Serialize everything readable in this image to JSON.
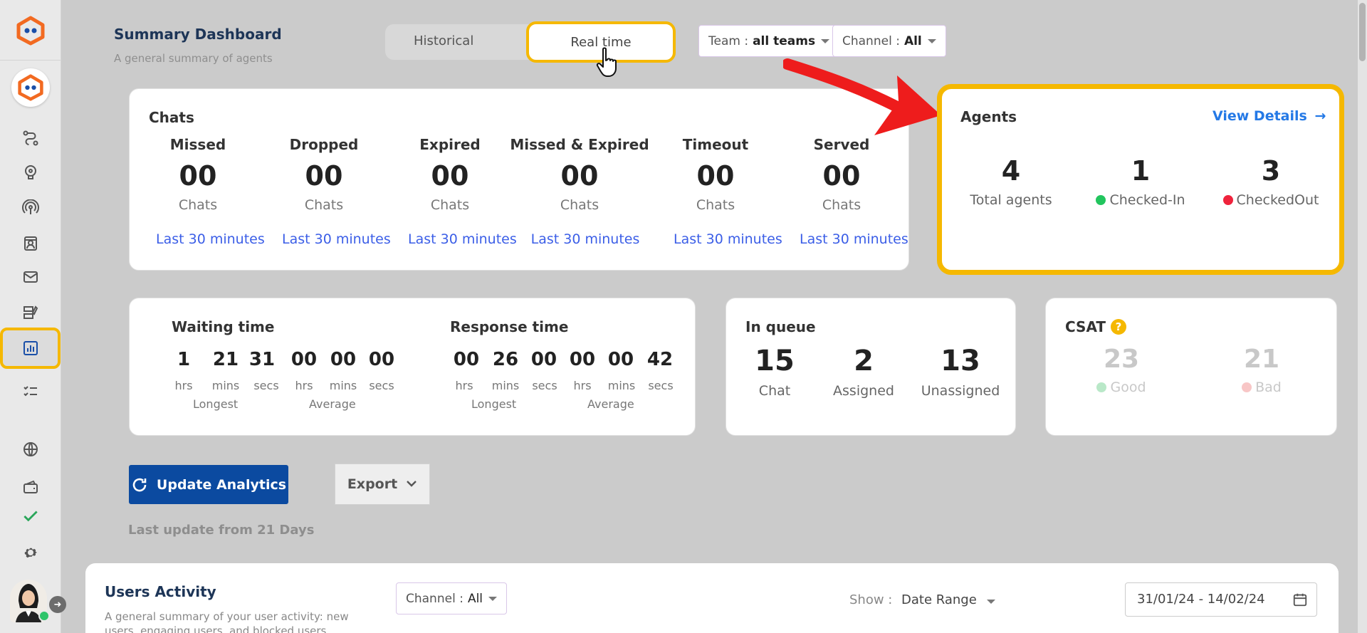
{
  "header": {
    "title": "Summary Dashboard",
    "subtitle": "A general summary of agents",
    "tabs": [
      "Historical",
      "Real time"
    ],
    "team_label": "Team :",
    "team_value": "all teams",
    "channel_label": "Channel :",
    "channel_value": "All"
  },
  "chats": {
    "title": "Chats",
    "columns": [
      {
        "label": "Missed",
        "value": "00",
        "unit": "Chats",
        "period": "Last 30 minutes"
      },
      {
        "label": "Dropped",
        "value": "00",
        "unit": "Chats",
        "period": "Last 30 minutes"
      },
      {
        "label": "Expired",
        "value": "00",
        "unit": "Chats",
        "period": "Last 30 minutes"
      },
      {
        "label": "Missed & Expired",
        "value": "00",
        "unit": "Chats",
        "period": "Last 30 minutes"
      },
      {
        "label": "Timeout",
        "value": "00",
        "unit": "Chats",
        "period": "Last 30 minutes"
      },
      {
        "label": "Served",
        "value": "00",
        "unit": "Chats",
        "period": "Last 30 minutes"
      }
    ]
  },
  "agents": {
    "title": "Agents",
    "view_details": "View Details",
    "total": "4",
    "total_label": "Total agents",
    "checked_in": "1",
    "checked_in_label": "Checked-In",
    "checked_out": "3",
    "checked_out_label": "CheckedOut",
    "checked_in_color": "#22c55e",
    "checked_out_color": "#ef233c"
  },
  "waiting_time": {
    "title": "Waiting time",
    "values": [
      "1",
      "21",
      "31",
      "00",
      "00",
      "00"
    ],
    "units": [
      "hrs",
      "mins",
      "secs",
      "hrs",
      "mins",
      "secs"
    ],
    "longest": "Longest",
    "average": "Average"
  },
  "response_time": {
    "title": "Response time",
    "values": [
      "00",
      "26",
      "00",
      "00",
      "00",
      "42"
    ],
    "units": [
      "hrs",
      "mins",
      "secs",
      "hrs",
      "mins",
      "secs"
    ],
    "longest": "Longest",
    "average": "Average"
  },
  "queue": {
    "title": "In queue",
    "chat": "15",
    "chat_label": "Chat",
    "assigned": "2",
    "assigned_label": "Assigned",
    "unassigned": "13",
    "unassigned_label": "Unassigned"
  },
  "csat": {
    "title": "CSAT",
    "good": "23",
    "good_label": "Good",
    "bad": "21",
    "bad_label": "Bad"
  },
  "actions": {
    "update": "Update Analytics",
    "export": "Export",
    "last_update": "Last update from 21 Days"
  },
  "users_activity": {
    "title": "Users Activity",
    "subtitle": "A general summary of your user activity: new users, engaging users, and blocked users",
    "channel_label": "Channel :",
    "channel_value": "All",
    "show_label": "Show :",
    "show_value": "Date Range",
    "date_range": "31/01/24 - 14/02/24"
  },
  "colors": {
    "accent": "#f5b800",
    "primary": "#0b4aa0",
    "link": "#3b5ee7"
  }
}
